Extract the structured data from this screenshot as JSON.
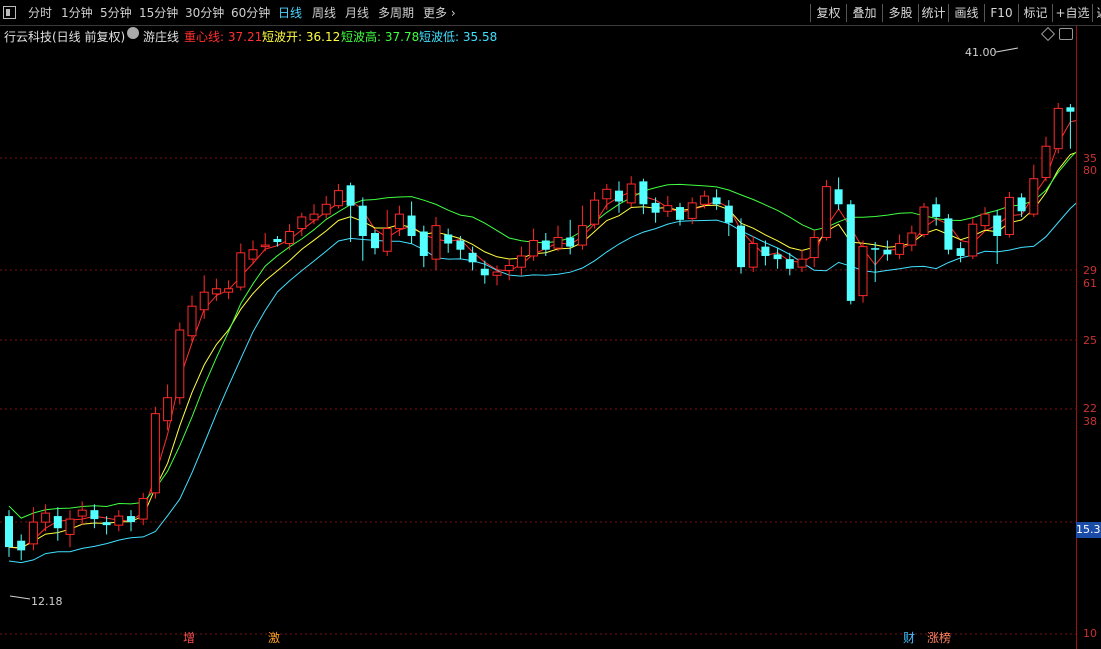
{
  "toolbar": {
    "periods": [
      "分时",
      "1分钟",
      "5分钟",
      "15分钟",
      "30分钟",
      "60分钟",
      "日线",
      "周线",
      "月线",
      "多周期",
      "更多"
    ],
    "active_period": "日线",
    "right_buttons": [
      "复权",
      "叠加",
      "多股",
      "统计",
      "画线",
      "F10",
      "标记",
      "+自选",
      "返"
    ]
  },
  "infobar": {
    "stock": "行云科技(日线 前复权)",
    "indicator": "游庄线",
    "items": [
      {
        "label": "重心线:",
        "value": "37.21",
        "color": "#ff3030"
      },
      {
        "label": "短波开:",
        "value": "36.12",
        "color": "#ffff40"
      },
      {
        "label": "短波高:",
        "value": "37.78",
        "color": "#40ff40"
      },
      {
        "label": "短波低:",
        "value": "35.58",
        "color": "#40e0ff"
      }
    ]
  },
  "axis": {
    "labels": [
      "35",
      "80",
      "29",
      "61",
      "25",
      "22",
      "38",
      "15.3",
      "10"
    ]
  },
  "annotations": {
    "high": "41.00",
    "low": "12.18"
  },
  "bottom_tags": [
    {
      "text": "增",
      "color": "#ff5050"
    },
    {
      "text": "激",
      "color": "#ffa020"
    },
    {
      "text": "财",
      "color": "#40c0ff"
    },
    {
      "text": "涨榜",
      "color": "#ff8060"
    }
  ],
  "chart_data": {
    "type": "candlestick",
    "series": [
      {
        "name": "重心线",
        "color": "#ff3030"
      },
      {
        "name": "短波开",
        "color": "#ffff40"
      },
      {
        "name": "短波高",
        "color": "#40ff40"
      },
      {
        "name": "短波低",
        "color": "#40e0ff"
      }
    ],
    "candles": [
      [
        13.6,
        12.6,
        13.8,
        12.3
      ],
      [
        12.8,
        12.5,
        13.0,
        12.2
      ],
      [
        12.7,
        13.4,
        13.9,
        12.5
      ],
      [
        13.4,
        13.7,
        14.0,
        13.1
      ],
      [
        13.6,
        13.2,
        13.9,
        12.8
      ],
      [
        13.0,
        13.5,
        13.8,
        12.6
      ],
      [
        13.6,
        13.8,
        14.1,
        13.3
      ],
      [
        13.8,
        13.5,
        14.0,
        13.2
      ],
      [
        13.4,
        13.3,
        13.6,
        13.0
      ],
      [
        13.3,
        13.6,
        13.8,
        13.1
      ],
      [
        13.6,
        13.4,
        13.8,
        13.1
      ],
      [
        13.5,
        14.2,
        14.4,
        13.3
      ],
      [
        14.4,
        17.5,
        17.8,
        14.2
      ],
      [
        17.2,
        18.2,
        18.8,
        16.8
      ],
      [
        18.2,
        21.5,
        21.9,
        17.9
      ],
      [
        21.2,
        22.8,
        23.4,
        20.9
      ],
      [
        22.6,
        23.6,
        24.6,
        22.1
      ],
      [
        23.5,
        23.8,
        24.4,
        23.1
      ],
      [
        23.6,
        23.8,
        24.3,
        23.2
      ],
      [
        23.9,
        26.0,
        26.6,
        23.7
      ],
      [
        25.6,
        26.2,
        26.8,
        25.3
      ],
      [
        26.4,
        26.5,
        27.3,
        26.1
      ],
      [
        26.9,
        26.7,
        27.1,
        26.4
      ],
      [
        26.6,
        27.4,
        27.9,
        26.2
      ],
      [
        27.6,
        28.4,
        28.7,
        27.1
      ],
      [
        28.2,
        28.6,
        29.3,
        27.9
      ],
      [
        28.6,
        29.3,
        29.9,
        28.3
      ],
      [
        29.2,
        30.3,
        30.8,
        29.0
      ],
      [
        30.7,
        29.2,
        30.9,
        26.7
      ],
      [
        29.2,
        27.1,
        29.8,
        25.5
      ],
      [
        27.3,
        26.3,
        27.5,
        25.9
      ],
      [
        26.1,
        27.6,
        28.9,
        25.8
      ],
      [
        27.6,
        28.6,
        29.2,
        27.1
      ],
      [
        28.5,
        27.1,
        29.5,
        26.6
      ],
      [
        27.4,
        25.8,
        27.8,
        25.1
      ],
      [
        25.6,
        27.8,
        28.4,
        24.9
      ],
      [
        27.2,
        26.6,
        27.6,
        26.0
      ],
      [
        26.8,
        26.2,
        27.1,
        25.6
      ],
      [
        26.0,
        25.4,
        26.4,
        24.9
      ],
      [
        25.0,
        24.6,
        25.5,
        24.1
      ],
      [
        24.6,
        24.8,
        25.2,
        24.0
      ],
      [
        24.9,
        25.2,
        25.6,
        24.3
      ],
      [
        25.1,
        25.8,
        26.4,
        24.6
      ],
      [
        25.8,
        26.8,
        27.6,
        25.5
      ],
      [
        26.8,
        26.2,
        27.3,
        25.8
      ],
      [
        26.3,
        27.0,
        27.8,
        26.1
      ],
      [
        27.0,
        26.4,
        28.2,
        25.9
      ],
      [
        26.5,
        27.8,
        29.2,
        26.2
      ],
      [
        27.9,
        29.6,
        30.2,
        27.6
      ],
      [
        29.7,
        30.4,
        30.8,
        28.9
      ],
      [
        30.3,
        29.5,
        31.0,
        28.7
      ],
      [
        29.4,
        30.8,
        31.4,
        29.1
      ],
      [
        31.0,
        29.3,
        31.2,
        28.6
      ],
      [
        29.4,
        28.7,
        29.8,
        28.0
      ],
      [
        28.8,
        29.2,
        29.9,
        28.4
      ],
      [
        29.1,
        28.2,
        29.4,
        27.8
      ],
      [
        28.3,
        29.4,
        29.8,
        27.9
      ],
      [
        29.3,
        29.9,
        30.3,
        29.0
      ],
      [
        29.8,
        29.3,
        30.4,
        28.9
      ],
      [
        29.2,
        28.0,
        29.6,
        27.1
      ],
      [
        27.8,
        25.1,
        28.3,
        24.7
      ],
      [
        25.1,
        26.6,
        27.1,
        24.8
      ],
      [
        26.4,
        25.8,
        26.8,
        25.2
      ],
      [
        25.9,
        25.6,
        26.3,
        25.0
      ],
      [
        25.6,
        25.0,
        26.0,
        24.6
      ],
      [
        25.1,
        25.6,
        26.2,
        24.8
      ],
      [
        25.7,
        27.0,
        27.5,
        25.1
      ],
      [
        27.0,
        30.6,
        31.1,
        26.8
      ],
      [
        30.4,
        29.3,
        31.3,
        28.9
      ],
      [
        29.3,
        23.1,
        29.6,
        22.9
      ],
      [
        23.4,
        26.4,
        26.8,
        23.0
      ],
      [
        26.3,
        26.2,
        26.7,
        24.2
      ],
      [
        26.2,
        25.9,
        26.8,
        25.5
      ],
      [
        25.9,
        26.6,
        27.2,
        25.6
      ],
      [
        26.5,
        27.3,
        27.8,
        26.1
      ],
      [
        27.2,
        29.1,
        29.4,
        27.0
      ],
      [
        29.3,
        28.4,
        29.8,
        27.8
      ],
      [
        28.3,
        26.2,
        28.6,
        25.9
      ],
      [
        26.3,
        25.8,
        26.7,
        25.4
      ],
      [
        25.8,
        27.9,
        28.3,
        25.6
      ],
      [
        27.8,
        28.6,
        29.1,
        27.5
      ],
      [
        28.5,
        27.1,
        28.9,
        25.3
      ],
      [
        27.2,
        29.8,
        30.2,
        27.0
      ],
      [
        29.8,
        28.8,
        30.1,
        28.4
      ],
      [
        28.6,
        31.2,
        32.3,
        28.4
      ],
      [
        31.3,
        33.8,
        34.6,
        31.0
      ],
      [
        33.6,
        37.1,
        37.6,
        33.2
      ],
      [
        37.2,
        36.8,
        37.5,
        33.6
      ],
      [
        36.7,
        34.5,
        37.1,
        34.0
      ],
      [
        34.6,
        35.6,
        36.2,
        34.2
      ],
      [
        35.6,
        37.8,
        38.1,
        34.9
      ],
      [
        37.9,
        38.4,
        39.2,
        37.4
      ],
      [
        38.6,
        36.1,
        38.7,
        35.9
      ],
      [
        36.3,
        39.6,
        40.1,
        36.1
      ],
      [
        39.7,
        38.0,
        40.3,
        37.1
      ],
      [
        37.8,
        36.6,
        38.4,
        36.1
      ],
      [
        36.5,
        39.9,
        41.0,
        36.3
      ],
      [
        38.3,
        36.9,
        39.9,
        35.5
      ]
    ],
    "up_color": "#ff2a2a",
    "down_color": "#54ffff",
    "ylim": [
      10,
      42
    ],
    "log_scale": true
  }
}
